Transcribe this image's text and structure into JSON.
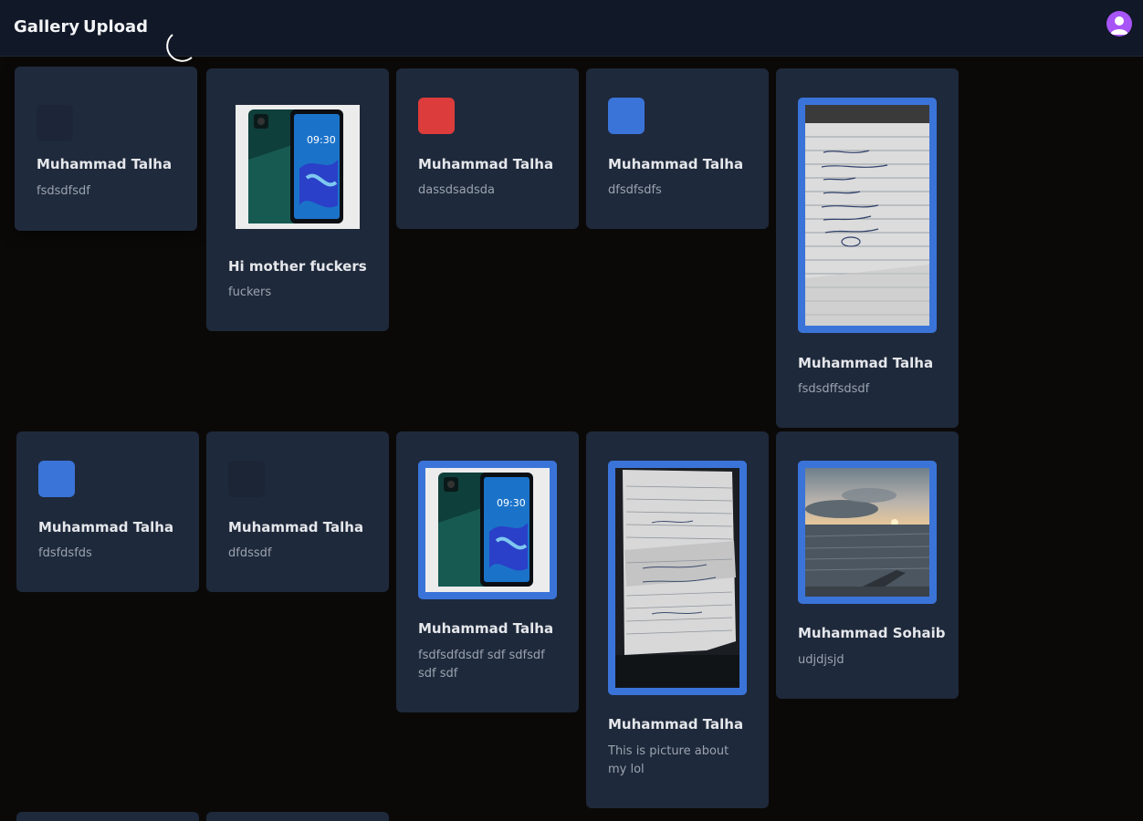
{
  "nav": {
    "gallery": "Gallery",
    "upload": "Upload",
    "theme_icon": "moon-icon",
    "profile_icon": "user-avatar-icon",
    "avatar_color": "#a855f7"
  },
  "cards": [
    {
      "title": "Muhammad Talha",
      "desc": "fsdsdfsdf",
      "thumb": "empty-square"
    },
    {
      "title": "Hi mother fuckers",
      "desc": "fuckers",
      "thumb": "phone-photo"
    },
    {
      "title": "Muhammad Talha",
      "desc": "dassdsadsda",
      "thumb": "red-square",
      "color": "#dc3c3c"
    },
    {
      "title": "Muhammad Talha",
      "desc": "dfsdfsdfs",
      "thumb": "blue-square",
      "color": "#3b74d9"
    },
    {
      "title": "Muhammad Talha",
      "desc": "fsdsdffsdsdf",
      "thumb": "notebook-photo"
    },
    {
      "title": "Muhammad Talha",
      "desc": "fdsfdsfds",
      "thumb": "blue-square",
      "color": "#3b74d9"
    },
    {
      "title": "Muhammad Talha",
      "desc": "dfdssdf",
      "thumb": "empty-square"
    },
    {
      "title": "Muhammad Talha",
      "desc": "fsdfsdfdsdf sdf sdfsdf sdf sdf",
      "thumb": "phone-photo"
    },
    {
      "title": "Muhammad Talha",
      "desc": "This is picture about my lol",
      "thumb": "crumpled-paper-photo"
    },
    {
      "title": "Muhammad Sohaib",
      "desc": "udjdjsjd",
      "thumb": "sunset-sea-photo"
    }
  ],
  "colors": {
    "page_bg": "#0b0908",
    "navbar_bg": "#111827",
    "card_bg": "#1e293b",
    "frame_accent": "#3b74d9"
  }
}
